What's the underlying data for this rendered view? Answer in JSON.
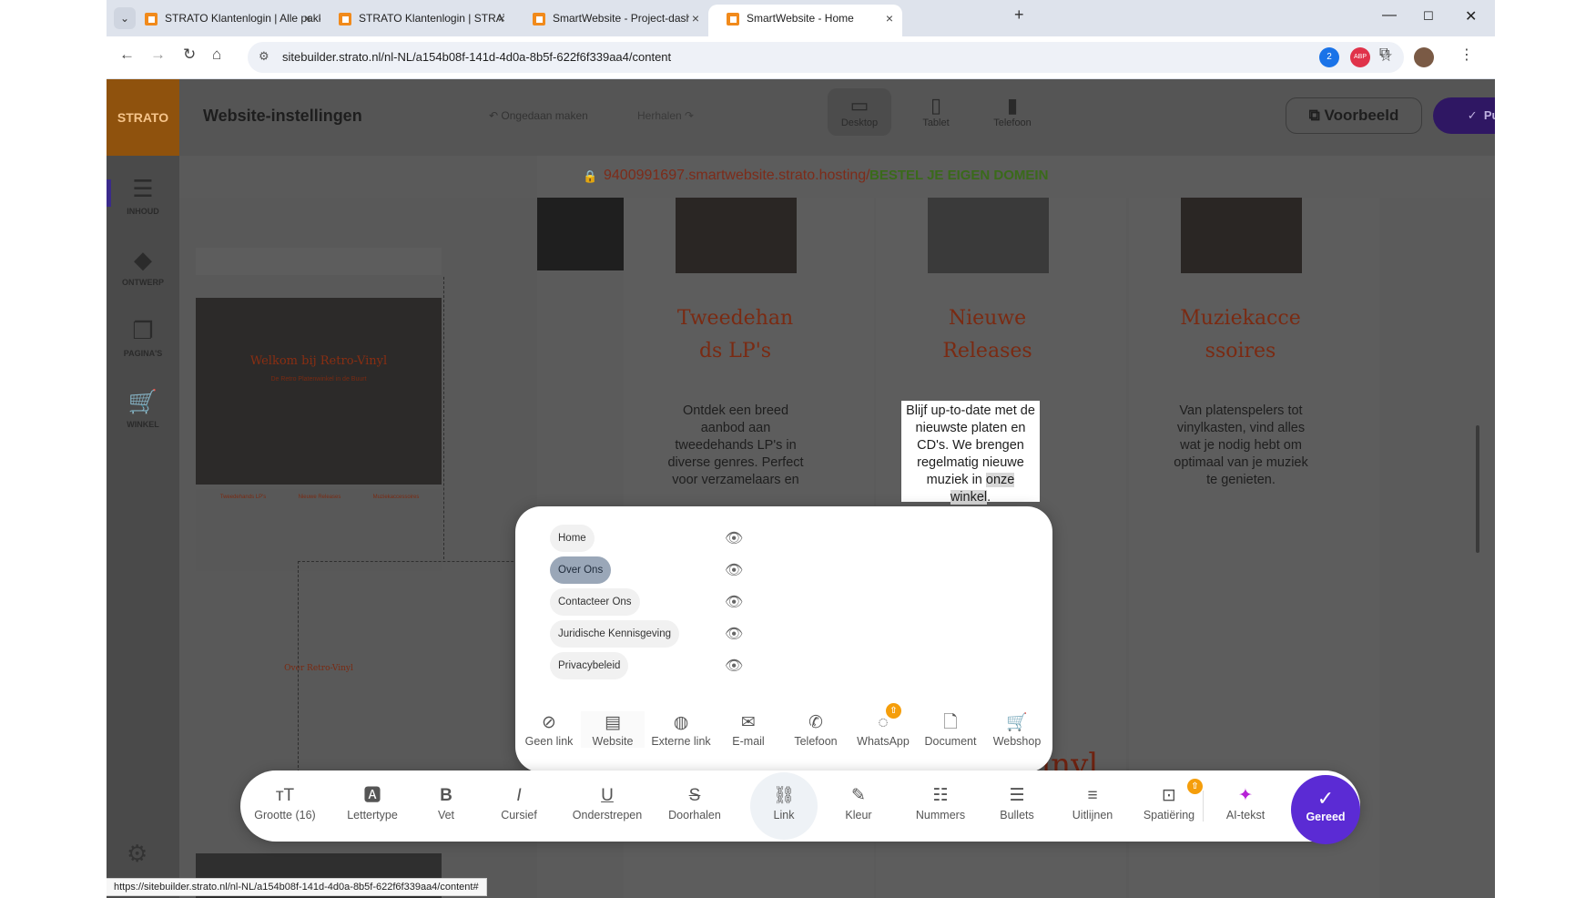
{
  "browser": {
    "tabs": [
      {
        "title": "STRATO Klantenlogin | Alle pakketten",
        "active": false
      },
      {
        "title": "STRATO Klantenlogin | STRATO",
        "active": false
      },
      {
        "title": "SmartWebsite - Project-dashboard",
        "active": false
      },
      {
        "title": "SmartWebsite - Home",
        "active": true
      }
    ],
    "url": "sitebuilder.strato.nl/nl-NL/a154b08f-141d-4d0a-8b5f-622f6f339aa4/content",
    "status_url": "https://sitebuilder.strato.nl/nl-NL/a154b08f-141d-4d0a-8b5f-622f6f339aa4/content#",
    "ext_badge": "2",
    "abp_label": "ABP"
  },
  "rail": {
    "logo": "STRATO",
    "items": [
      {
        "label": "INHOUD",
        "icon": "content-icon"
      },
      {
        "label": "ONTWERP",
        "icon": "design-icon"
      },
      {
        "label": "PAGINA'S",
        "icon": "pages-icon"
      },
      {
        "label": "WINKEL",
        "icon": "cart-icon"
      }
    ]
  },
  "topbar": {
    "title": "Website-instellingen",
    "undo": "Ongedaan maken",
    "redo": "Herhalen",
    "devices": [
      "Desktop",
      "Tablet",
      "Telefoon"
    ],
    "preview": "Voorbeeld",
    "publish": "Publiceren"
  },
  "domain": {
    "address": "9400991697.smartwebsite.strato.hosting/",
    "buy": "BESTEL JE EIGEN DOMEIN"
  },
  "thumbs": {
    "hero_title": "Welkom bij Retro-Vinyl",
    "hero_sub": "De Retro Platenwinkel in de Buurt",
    "about": "Over Retro-Vinyl",
    "mini_cols": [
      "Tweedehands LP's",
      "Nieuwe Releases",
      "Muziekaccessoires"
    ]
  },
  "columns": [
    {
      "title_l1": "Tweedehan",
      "title_l2": "ds LP's",
      "text": "Ontdek een breed aanbod aan tweedehands LP's in diverse genres. Perfect voor verzamelaars en"
    },
    {
      "title_l1": "Nieuwe",
      "title_l2": "Releases",
      "text_a": "Blijf up-to-date met de nieuwste platen en CD's. We brengen regelmatig nieuwe muziek in ",
      "text_hl1": "onze",
      "text_hl2": "winkel",
      "text_end": "."
    },
    {
      "title_l1": "Muziekacce",
      "title_l2": "ssoires",
      "text": "Van platenspelers tot vinylkasten, vind alles wat je nodig hebt om optimaal van je muziek te genieten."
    }
  ],
  "big_heading": "Over Retro-Vinyl",
  "link_panel": {
    "pages": [
      "Home",
      "Over Ons",
      "Contacteer Ons",
      "Juridische Kennisgeving",
      "Privacybeleid"
    ],
    "selected_page": "Over Ons",
    "types": [
      "Geen link",
      "Website",
      "Externe link",
      "E-mail",
      "Telefoon",
      "WhatsApp",
      "Document",
      "Webshop"
    ],
    "active_type": "Website"
  },
  "format_bar": {
    "items": [
      "Grootte (16)",
      "Lettertype",
      "Vet",
      "Cursief",
      "Onderstrepen",
      "Doorhalen",
      "Link",
      "Kleur",
      "Nummers",
      "Bullets",
      "Uitlijnen",
      "Spatiëring",
      "AI-tekst"
    ],
    "active": "Link",
    "done": "Gereed"
  },
  "colors": {
    "strato_orange": "#f18a1b",
    "publish_purple": "#5b2bd4",
    "heading_red": "#7a2a12",
    "domain_green": "#3a6a1a",
    "upgrade_badge": "#f59e0b"
  }
}
